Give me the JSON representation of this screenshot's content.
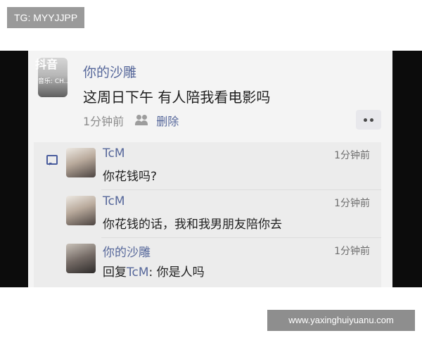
{
  "overlay": {
    "tg_label": "TG: MYYJJPP",
    "watermark_url": "www.yaxinghuiyuanu.com"
  },
  "tiktok": {
    "logo_text": "抖音",
    "note_text": "音乐: CH..."
  },
  "post": {
    "username": "你的沙雕",
    "content": "这周日下午  有人陪我看电影吗",
    "time": "1分钟前",
    "delete_label": "删除"
  },
  "comments": [
    {
      "username": "TcM",
      "time": "1分钟前",
      "text": "你花钱吗?"
    },
    {
      "username": "TcM",
      "time": "1分钟前",
      "text": "你花钱的话，我和我男朋友陪你去"
    },
    {
      "username": "你的沙雕",
      "time": "1分钟前",
      "reply_prefix": "回复",
      "reply_to": "TcM",
      "reply_text": ": 你是人吗"
    }
  ],
  "colors": {
    "username_blue": "#56679a",
    "screen_bg": "#f4f4f4",
    "comment_bg": "#ececec"
  }
}
